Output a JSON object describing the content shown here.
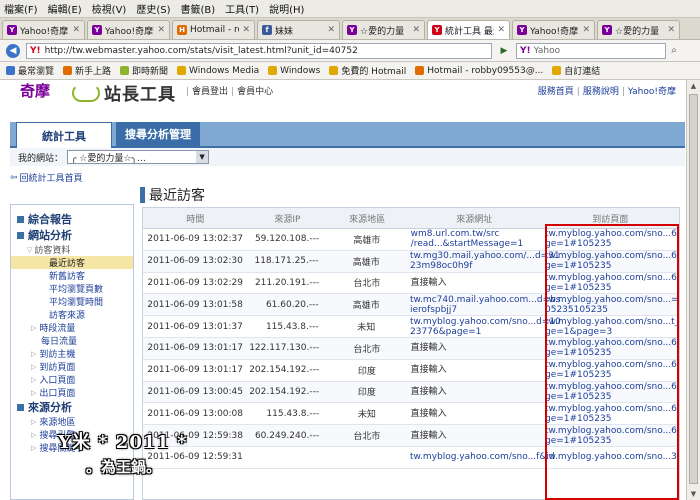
{
  "menu": [
    "檔案(F)",
    "編輯(E)",
    "檢視(V)",
    "歷史(S)",
    "書籤(B)",
    "工具(T)",
    "說明(H)"
  ],
  "tabs": [
    {
      "title": "Yahoo!奇摩",
      "icon": "Y",
      "color": "#7b0099",
      "active": false
    },
    {
      "title": "Yahoo!奇摩部落格",
      "icon": "Y",
      "color": "#7b0099",
      "active": false
    },
    {
      "title": "Hotmail - robby095",
      "icon": "H",
      "color": "#e06c00",
      "active": false
    },
    {
      "title": "妹妹",
      "icon": "f",
      "color": "#3b5998",
      "active": false
    },
    {
      "title": "☆愛的力量",
      "icon": "Y",
      "color": "#7b0099",
      "active": false
    },
    {
      "title": "統計工具 最近",
      "icon": "Y",
      "color": "#d0021b",
      "active": true
    },
    {
      "title": "Yahoo!奇摩",
      "icon": "Y",
      "color": "#7b0099",
      "active": false
    },
    {
      "title": "☆愛的力量",
      "icon": "Y",
      "color": "#7b0099",
      "active": false
    }
  ],
  "address": {
    "url": "http://tw.webmaster.yahoo.com/stats/visit_latest.html?unit_id=40752",
    "search_placeholder": "Yahoo"
  },
  "bookmarks": [
    {
      "label": "最常瀏覽",
      "color": "#3b73c9"
    },
    {
      "label": "新手上路",
      "color": "#e06c00"
    },
    {
      "label": "即時新聞",
      "color": "#8fb32d"
    },
    {
      "label": "Windows Media",
      "color": "#e0a800"
    },
    {
      "label": "Windows",
      "color": "#e0a800"
    },
    {
      "label": "免費的 Hotmail",
      "color": "#e0a800"
    },
    {
      "label": "Hotmail - robby09553@...",
      "color": "#e06c00"
    },
    {
      "label": "自訂連結",
      "color": "#e0a800"
    }
  ],
  "header": {
    "logo_text": "奇摩",
    "site_title": "站長工具",
    "logout": "會員登出",
    "member_center": "會員中心",
    "service_home": "服務首頁",
    "service_help": "服務說明",
    "yahoo_home": "Yahoo!奇摩"
  },
  "nav": {
    "active_tab": "統計工具",
    "other_tab": "搜尋分析管理"
  },
  "site_select": {
    "label": "我的網站：",
    "value": "╭ ☆愛的力量☆╮…"
  },
  "back_link": "回統計工具首頁",
  "page_title": "最近訪客",
  "sidebar": {
    "group1": "綜合報告",
    "group2": "網站分析",
    "sub_visitors": "訪客資料",
    "visitor_items": [
      "最近訪客",
      "新舊訪客",
      "平均瀏覽頁數",
      "平均瀏覽時間",
      "訪客來源"
    ],
    "expanders": [
      "時段流量"
    ],
    "daily": "每日流量",
    "expanders2": [
      "到訪主機",
      "到訪頁面",
      "入口頁面",
      "出口頁面"
    ],
    "group3": "來源分析",
    "source_items": [
      "來源地區",
      "搜尋引擎",
      "搜尋關鍵字"
    ]
  },
  "table": {
    "headers": [
      "時間",
      "來源IP",
      "來源地區",
      "來源網址",
      "到訪頁面"
    ],
    "rows": [
      [
        "2011-06-09 13:02:37",
        "59.120.108.---",
        "高雄市",
        "wm8.url.com.tw/src\n/read...&startMessage=1",
        "tw.myblog.yahoo.com/sno...6&pa\nge=1#105235"
      ],
      [
        "2011-06-09 13:02:30",
        "118.171.25.---",
        "高雄市",
        "tw.mg30.mail.yahoo.com/...d=31\n23m98oc0h9f",
        "tw.myblog.yahoo.com/sno...6&pa\nge=1#105235"
      ],
      [
        "2011-06-09 13:02:29",
        "211.20.191.---",
        "台北市",
        "直接輸入",
        "tw.myblog.yahoo.com/sno...6&pa\nge=1#105235"
      ],
      [
        "2011-06-09 13:01:58",
        "61.60.20.---",
        "高雄市",
        "tw.mc740.mail.yahoo.com...d=bs\nierofspbjj7",
        "tw.myblog.yahoo.com/sno...=1#1\n05235105235"
      ],
      [
        "2011-06-09 13:01:37",
        "115.43.8.---",
        "未知",
        "tw.myblog.yahoo.com/sno...d=10\n23776&page=1",
        "tw.myblog.yahoo.com/sno...t_pa\nge=1&page=3"
      ],
      [
        "2011-06-09 13:01:17",
        "122.117.130.---",
        "台北市",
        "直接輸入",
        "tw.myblog.yahoo.com/sno...6&pa\nge=1#105235"
      ],
      [
        "2011-06-09 13:01:17",
        "202.154.192.---",
        "印度",
        "直接輸入",
        "tw.myblog.yahoo.com/sno...6&pa\nge=1#105235"
      ],
      [
        "2011-06-09 13:00:45",
        "202.154.192.---",
        "印度",
        "直接輸入",
        "tw.myblog.yahoo.com/sno...6&pa\nge=1#105235"
      ],
      [
        "2011-06-09 13:00:08",
        "115.43.8.---",
        "未知",
        "直接輸入",
        "tw.myblog.yahoo.com/sno...6&pa\nge=1#105235"
      ],
      [
        "2011-06-09 12:59:38",
        "60.249.240.---",
        "台北市",
        "直接輸入",
        "tw.myblog.yahoo.com/sno...6&pa\nge=1#105235"
      ],
      [
        "2011-06-09 12:59:31",
        "",
        "",
        "tw.myblog.yahoo.com/sno...f&id",
        "tw.myblog.yahoo.com/sno...3271"
      ]
    ]
  },
  "watermark": {
    "line1": "Y米 * 2011 *",
    "line2": "。為王鍋。"
  }
}
